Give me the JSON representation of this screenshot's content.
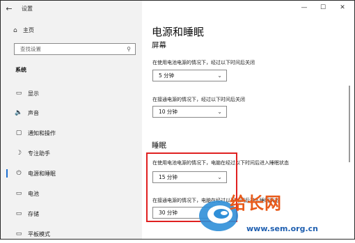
{
  "window": {
    "title": "设置",
    "back_icon": "←",
    "minimize": "—",
    "maximize": "☐",
    "close": "✕"
  },
  "sidebar": {
    "home": {
      "label": "主页",
      "icon": "⌂"
    },
    "search": {
      "placeholder": "查找设置",
      "icon": "⚲"
    },
    "section": "系统",
    "items": [
      {
        "label": "显示",
        "icon": "▭"
      },
      {
        "label": "声音",
        "icon": "🔈"
      },
      {
        "label": "通知和操作",
        "icon": "▢"
      },
      {
        "label": "专注助手",
        "icon": "☽"
      },
      {
        "label": "电源和睡眠",
        "icon": "⏻"
      },
      {
        "label": "电池",
        "icon": "▭"
      },
      {
        "label": "存储",
        "icon": "▭"
      },
      {
        "label": "平板模式",
        "icon": "▭"
      }
    ],
    "active_index": 4
  },
  "main": {
    "title": "电源和睡眠",
    "screen": {
      "heading": "屏幕",
      "battery_label": "在使用电池电源的情况下，经过以下时间后关闭",
      "battery_value": "5 分钟",
      "plugged_label": "在接通电源的情况下，经过以下时间后关闭",
      "plugged_value": "10 分钟"
    },
    "sleep": {
      "heading": "睡眠",
      "battery_label": "在使用电池电源的情况下，电脑在经过以下时间后进入睡眠状态",
      "battery_value": "15 分钟",
      "plugged_label": "在接通电源的情况下，电脑在经过以下时间后进入睡眠状态",
      "plugged_value": "30 分钟"
    }
  },
  "watermark": {
    "text": "给长网",
    "url": "www.sem.org.cn"
  },
  "colors": {
    "accent": "#1d6fd0",
    "highlight": "#e02020",
    "sidebar_bg": "#f2f2f2"
  }
}
